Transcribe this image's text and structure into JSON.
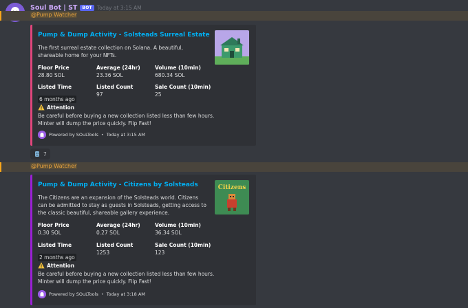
{
  "message": {
    "username": "Soul Bot | ST",
    "bot_badge": "BOT",
    "timestamp": "Today at 3:15 AM"
  },
  "embeds": [
    {
      "mention": "@Pump Watcher",
      "title": "Pump & Dump Activity - Solsteads Surreal Estate",
      "description": "The first surreal estate collection on Solana. A beautiful, shareable home for your NFTs.",
      "accent_color": "#e0457b",
      "thumbnail_icon": "pixel-house-icon",
      "fields": {
        "floor_price_name": "Floor Price",
        "floor_price": "28.80 SOL",
        "average_name": "Average (24hr)",
        "average": "23.36 SOL",
        "volume_name": "Volume (10min)",
        "volume": "680.34 SOL",
        "listed_time_name": "Listed Time",
        "listed_time": "6 months ago",
        "listed_count_name": "Listed Count",
        "listed_count": "97",
        "sale_count_name": "Sale Count (10min)",
        "sale_count": "25"
      },
      "attention_title": "Attention",
      "attention_text": "Be careful before buying a new collection listed less than few hours. Minter will dump the price quickly. Flip Fast!",
      "footer_text": "Powered by SOuLTools",
      "footer_time": "Today at 3:15 AM"
    },
    {
      "mention": "@Pump Watcher",
      "title": "Pump & Dump Activity - Citizens by Solsteads",
      "description": "The Citizens are an expansion of the Solsteads world. Citizens can be admitted to stay as guests in Solsteads, getting access to the classic beautiful, shareable gallery experience.",
      "accent_color": "#9b1fd6",
      "thumbnail_icon": "citizens-logo-icon",
      "thumbnail_text": "Citizens",
      "fields": {
        "floor_price_name": "Floor Price",
        "floor_price": "0.30 SOL",
        "average_name": "Average (24hr)",
        "average": "0.27 SOL",
        "volume_name": "Volume (10min)",
        "volume": "36.34 SOL",
        "listed_time_name": "Listed Time",
        "listed_time": "2 months ago",
        "listed_count_name": "Listed Count",
        "listed_count": "1253",
        "sale_count_name": "Sale Count (10min)",
        "sale_count": "123"
      },
      "attention_title": "Attention",
      "attention_text": "Be careful before buying a new collection listed less than few hours. Minter will dump the price quickly. Flip Fast!",
      "footer_text": "Powered by SOuLTools",
      "footer_time": "Today at 3:18 AM"
    }
  ],
  "reaction": {
    "icon": "moai-emoji-icon",
    "count": "7"
  },
  "colors": {
    "link": "#00b0f4",
    "mention": "#e8a33e",
    "background": "#36393f",
    "embed_bg": "#2f3136"
  }
}
